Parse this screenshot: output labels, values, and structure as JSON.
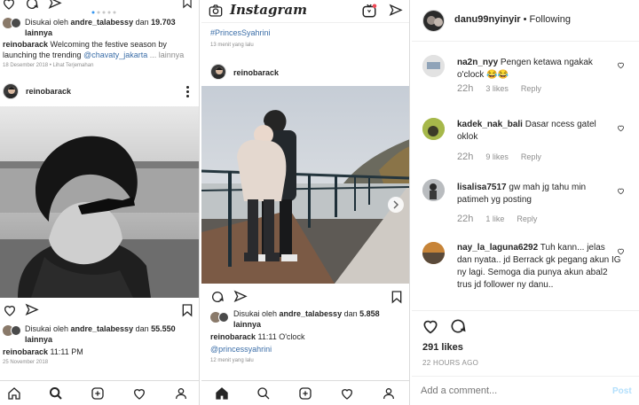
{
  "panel1": {
    "top_post": {
      "liked_by_line1": "Disukai oleh ",
      "liked_by_user": "andre_talabessy",
      "liked_by_and": " dan ",
      "liked_by_count": "19.703",
      "liked_by_line2": "lainnya",
      "caption_user": "reinobarack",
      "caption_text1": " Welcoming the festive season by",
      "caption_text2": "launching the trending ",
      "caption_mention": "@chavaty_jakarta",
      "caption_more": " ... lainnya",
      "timestamp": "18 Desember 2018",
      "translate": " • Lihat Terjemahan"
    },
    "post_username": "reinobarack",
    "bottom_post": {
      "liked_by_line1": "Disukai oleh ",
      "liked_by_user": "andre_talabessy",
      "liked_by_and": " dan ",
      "liked_by_count": "55.550",
      "liked_by_line2": "lainnya",
      "caption_user": "reinobarack",
      "caption_text": " 11:11 PM",
      "timestamp": "25 November 2018"
    }
  },
  "panel2": {
    "header_title": "Instagram",
    "top_hashtag": "#PrincesSyahrini",
    "top_time": "13 menit yang lalu",
    "post_username": "reinobarack",
    "liked_by_line1": "Disukai oleh ",
    "liked_by_user": "andre_talabessy",
    "liked_by_and": " dan ",
    "liked_by_count": "5.858",
    "liked_by_line2": "lainnya",
    "caption_user": "reinobarack",
    "caption_text": " 11:11 O'clock",
    "caption_mention": "@princessyahrini",
    "time": "12 menit yang lalu"
  },
  "panel3": {
    "header_user": "danu99nyinyir",
    "header_sep": " • ",
    "header_follow": "Following",
    "comments": [
      {
        "user": "na2n_nyy",
        "text": " Pengen ketawa ngakak o'clock 😂😂",
        "time": "22h",
        "likes": "3 likes",
        "reply": "Reply"
      },
      {
        "user": "kadek_nak_bali",
        "text": " Dasar ncess gatel oklok",
        "time": "22h",
        "likes": "9 likes",
        "reply": "Reply"
      },
      {
        "user": "lisalisa7517",
        "text": " gw mah jg tahu min patimeh yg posting",
        "time": "22h",
        "likes": "1 like",
        "reply": "Reply"
      },
      {
        "user": "nay_la_laguna6292",
        "text": " Tuh kann... jelas dan nyata.. jd Berrack gk pegang akun IG ny lagi. Semoga dia punya akun abal2 trus jd follower ny danu..",
        "time": "",
        "likes": "",
        "reply": ""
      }
    ],
    "likes": "291 likes",
    "date": "22 HOURS AGO",
    "comment_placeholder": "Add a comment...",
    "post_label": "Post"
  }
}
